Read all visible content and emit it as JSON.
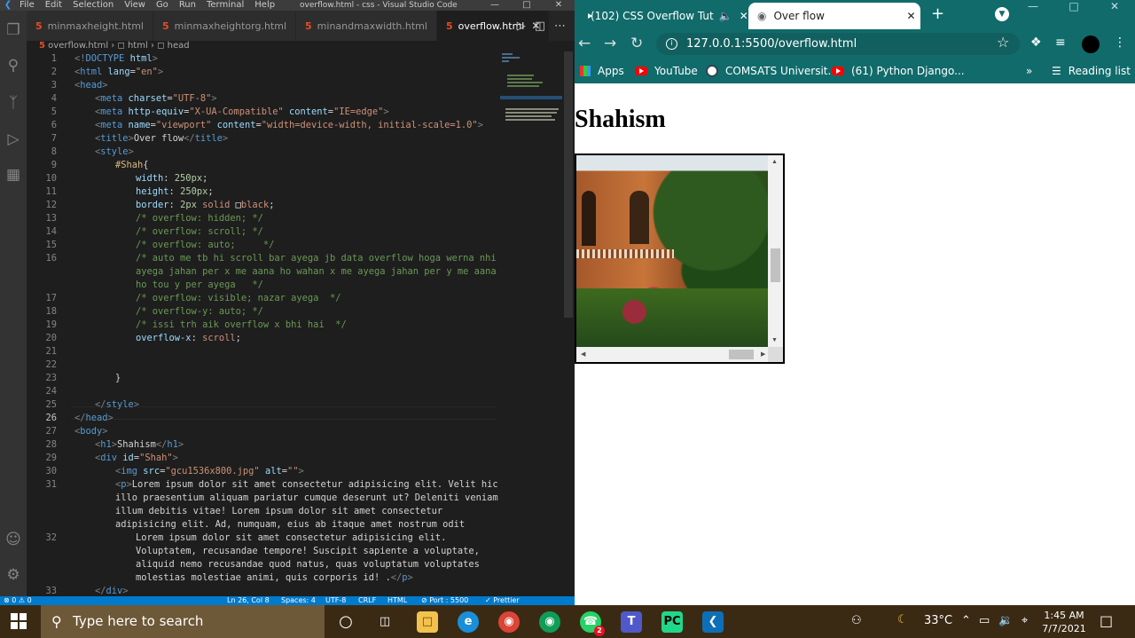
{
  "vscode": {
    "menu": [
      "File",
      "Edit",
      "Selection",
      "View",
      "Go",
      "Run",
      "Terminal",
      "Help"
    ],
    "title": "overflow.html - css - Visual Studio Code",
    "tabs": [
      {
        "label": "minmaxheight.html"
      },
      {
        "label": "minmaxheightorg.html"
      },
      {
        "label": "minandmaxwidth.html"
      },
      {
        "label": "overflow.html",
        "active": true
      }
    ],
    "breadcrumb": [
      "overflow.html",
      "html",
      "head"
    ],
    "line_numbers": [
      "1",
      "2",
      "3",
      "4",
      "5",
      "6",
      "7",
      "8",
      "9",
      "10",
      "11",
      "12",
      "13",
      "14",
      "15",
      "16",
      "",
      "",
      "17",
      "18",
      "19",
      "20",
      "21",
      "22",
      "23",
      "24",
      "25",
      "26",
      "27",
      "28",
      "29",
      "30",
      "31",
      "",
      "",
      "",
      "32",
      "",
      "",
      "",
      "33"
    ],
    "code": [
      {
        "ind": 0,
        "parts": [
          [
            "t",
            "<!"
          ],
          [
            "n",
            "DOCTYPE"
          ],
          [
            "a",
            " html"
          ],
          [
            "t",
            ">"
          ]
        ]
      },
      {
        "ind": 0,
        "parts": [
          [
            "t",
            "<"
          ],
          [
            "n",
            "html"
          ],
          [
            "a",
            " lang"
          ],
          [
            "d",
            "="
          ],
          [
            "s",
            "\"en\""
          ],
          [
            "t",
            ">"
          ]
        ]
      },
      {
        "ind": 0,
        "parts": [
          [
            "t",
            "<"
          ],
          [
            "n",
            "head"
          ],
          [
            "t",
            ">"
          ]
        ]
      },
      {
        "ind": 1,
        "parts": [
          [
            "t",
            "<"
          ],
          [
            "n",
            "meta"
          ],
          [
            "a",
            " charset"
          ],
          [
            "d",
            "="
          ],
          [
            "s",
            "\"UTF-8\""
          ],
          [
            "t",
            ">"
          ]
        ]
      },
      {
        "ind": 1,
        "parts": [
          [
            "t",
            "<"
          ],
          [
            "n",
            "meta"
          ],
          [
            "a",
            " http-equiv"
          ],
          [
            "d",
            "="
          ],
          [
            "s",
            "\"X-UA-Compatible\""
          ],
          [
            "a",
            " content"
          ],
          [
            "d",
            "="
          ],
          [
            "s",
            "\"IE=edge\""
          ],
          [
            "t",
            ">"
          ]
        ]
      },
      {
        "ind": 1,
        "parts": [
          [
            "t",
            "<"
          ],
          [
            "n",
            "meta"
          ],
          [
            "a",
            " name"
          ],
          [
            "d",
            "="
          ],
          [
            "s",
            "\"viewport\""
          ],
          [
            "a",
            " content"
          ],
          [
            "d",
            "="
          ],
          [
            "s",
            "\"width=device-width, initial-scale=1.0\""
          ],
          [
            "t",
            ">"
          ]
        ]
      },
      {
        "ind": 1,
        "parts": [
          [
            "t",
            "<"
          ],
          [
            "n",
            "title"
          ],
          [
            "t",
            ">"
          ],
          [
            "d",
            "Over flow"
          ],
          [
            "t",
            "</"
          ],
          [
            "n",
            "title"
          ],
          [
            "t",
            ">"
          ]
        ]
      },
      {
        "ind": 1,
        "parts": [
          [
            "t",
            "<"
          ],
          [
            "n",
            "style"
          ],
          [
            "t",
            ">"
          ]
        ]
      },
      {
        "ind": 2,
        "parts": [
          [
            "sel",
            "#Shah"
          ],
          [
            "d",
            "{"
          ]
        ]
      },
      {
        "ind": 3,
        "parts": [
          [
            "p",
            "width"
          ],
          [
            "d",
            ": "
          ],
          [
            "v",
            "250px"
          ],
          [
            "d",
            ";"
          ]
        ]
      },
      {
        "ind": 3,
        "parts": [
          [
            "p",
            "height"
          ],
          [
            "d",
            ": "
          ],
          [
            "v",
            "250px"
          ],
          [
            "d",
            ";"
          ]
        ]
      },
      {
        "ind": 3,
        "parts": [
          [
            "p",
            "border"
          ],
          [
            "d",
            ": "
          ],
          [
            "v",
            "2px"
          ],
          [
            "d",
            " "
          ],
          [
            "s",
            "solid"
          ],
          [
            "d",
            " "
          ],
          [
            "sw",
            "□"
          ],
          [
            "s",
            "black"
          ],
          [
            "d",
            ";"
          ]
        ]
      },
      {
        "ind": 3,
        "parts": [
          [
            "c",
            "/* overflow: hidden; */"
          ]
        ]
      },
      {
        "ind": 3,
        "parts": [
          [
            "c",
            "/* overflow: scroll; */"
          ]
        ]
      },
      {
        "ind": 3,
        "parts": [
          [
            "c",
            "/* overflow: auto;     */"
          ]
        ]
      },
      {
        "ind": 3,
        "parts": [
          [
            "c",
            "/* auto me tb hi scroll bar ayega jb data overflow hoga werna nhi"
          ]
        ]
      },
      {
        "ind": 3,
        "parts": [
          [
            "c",
            "ayega jahan per x me aana ho wahan x me ayega jahan per y me aana"
          ]
        ]
      },
      {
        "ind": 3,
        "parts": [
          [
            "c",
            "ho tou y per ayega   */"
          ]
        ]
      },
      {
        "ind": 3,
        "parts": [
          [
            "c",
            "/* overflow: visible; nazar ayega  */"
          ]
        ]
      },
      {
        "ind": 3,
        "parts": [
          [
            "c",
            "/* overflow-y: auto; */"
          ]
        ]
      },
      {
        "ind": 3,
        "parts": [
          [
            "c",
            "/* issi trh aik overflow x bhi hai  */"
          ]
        ]
      },
      {
        "ind": 3,
        "parts": [
          [
            "p",
            "overflow-x"
          ],
          [
            "d",
            ": "
          ],
          [
            "s",
            "scroll"
          ],
          [
            "d",
            ";"
          ]
        ]
      },
      {
        "ind": 0,
        "parts": []
      },
      {
        "ind": 0,
        "parts": []
      },
      {
        "ind": 2,
        "parts": [
          [
            "d",
            "}"
          ]
        ]
      },
      {
        "ind": 0,
        "parts": []
      },
      {
        "ind": 1,
        "parts": [
          [
            "t",
            "</"
          ],
          [
            "n",
            "style"
          ],
          [
            "t",
            ">"
          ]
        ]
      },
      {
        "ind": 0,
        "parts": [
          [
            "t",
            "</"
          ],
          [
            "n",
            "head"
          ],
          [
            "t",
            ">"
          ]
        ]
      },
      {
        "ind": 0,
        "parts": [
          [
            "t",
            "<"
          ],
          [
            "n",
            "body"
          ],
          [
            "t",
            ">"
          ]
        ]
      },
      {
        "ind": 1,
        "parts": [
          [
            "t",
            "<"
          ],
          [
            "n",
            "h1"
          ],
          [
            "t",
            ">"
          ],
          [
            "d",
            "Shahism"
          ],
          [
            "t",
            "</"
          ],
          [
            "n",
            "h1"
          ],
          [
            "t",
            ">"
          ]
        ]
      },
      {
        "ind": 1,
        "parts": [
          [
            "t",
            "<"
          ],
          [
            "n",
            "div"
          ],
          [
            "a",
            " id"
          ],
          [
            "d",
            "="
          ],
          [
            "s",
            "\"Shah\""
          ],
          [
            "t",
            ">"
          ]
        ]
      },
      {
        "ind": 2,
        "parts": [
          [
            "t",
            "<"
          ],
          [
            "n",
            "img"
          ],
          [
            "a",
            " src"
          ],
          [
            "d",
            "="
          ],
          [
            "s",
            "\"gcu1536x800.jpg\""
          ],
          [
            "a",
            " alt"
          ],
          [
            "d",
            "="
          ],
          [
            "s",
            "\"\""
          ],
          [
            "t",
            ">"
          ]
        ]
      },
      {
        "ind": 2,
        "parts": [
          [
            "t",
            "<"
          ],
          [
            "n",
            "p"
          ],
          [
            "t",
            ">"
          ],
          [
            "d",
            "Lorem ipsum dolor sit amet consectetur adipisicing elit. Velit hic"
          ]
        ]
      },
      {
        "ind": 2,
        "parts": [
          [
            "d",
            "illo praesentium aliquam pariatur cumque deserunt ut? Deleniti veniam"
          ]
        ]
      },
      {
        "ind": 2,
        "parts": [
          [
            "d",
            "illum debitis vitae! Lorem ipsum dolor sit amet consectetur"
          ]
        ]
      },
      {
        "ind": 2,
        "parts": [
          [
            "d",
            "adipisicing elit. Ad, numquam, eius ab itaque amet nostrum odit"
          ]
        ]
      },
      {
        "ind": 3,
        "parts": [
          [
            "d",
            "Lorem ipsum dolor sit amet consectetur adipisicing elit."
          ]
        ]
      },
      {
        "ind": 3,
        "parts": [
          [
            "d",
            "Voluptatem, recusandae tempore! Suscipit sapiente a voluptate,"
          ]
        ]
      },
      {
        "ind": 3,
        "parts": [
          [
            "d",
            "aliquid nemo recusandae quod natus, quas voluptatum voluptates"
          ]
        ]
      },
      {
        "ind": 3,
        "parts": [
          [
            "d",
            "molestias molestiae animi, quis corporis id! ."
          ],
          [
            "t",
            "</"
          ],
          [
            "n",
            "p"
          ],
          [
            "t",
            ">"
          ]
        ]
      },
      {
        "ind": 1,
        "parts": [
          [
            "t",
            "</"
          ],
          [
            "n",
            "div"
          ],
          [
            "t",
            ">"
          ]
        ]
      }
    ],
    "status": {
      "left": "⊗ 0 ⚠ 0",
      "position": "Ln 26, Col 8",
      "spaces": "Spaces: 4",
      "encoding": "UTF-8",
      "eol": "CRLF",
      "language": "HTML",
      "port": "⊘ Port : 5500",
      "prettier": "✓ Prettier"
    }
  },
  "chrome": {
    "tabs": [
      {
        "title": "(102) CSS Overflow Tut",
        "favicon": "youtube-icon"
      },
      {
        "title": "Over flow",
        "favicon": "globe-icon",
        "active": true
      }
    ],
    "url": "127.0.0.1:5500/overflow.html",
    "bookmarks": [
      {
        "label": "Apps",
        "icon": "apps-grid-icon"
      },
      {
        "label": "YouTube",
        "icon": "youtube-icon"
      },
      {
        "label": "COMSATS Universit...",
        "icon": "university-icon"
      },
      {
        "label": "(61) Python Django...",
        "icon": "youtube-icon"
      }
    ],
    "reading_list": "Reading list",
    "page": {
      "heading": "Shahism"
    }
  },
  "taskbar": {
    "search_placeholder": "Type here to search",
    "temperature": "33°C",
    "time": "1:45 AM",
    "date": "7/7/2021",
    "whatsapp_badge": "2"
  },
  "colors": {
    "vscode_bg": "#1e1e1e",
    "statusbar": "#007acc",
    "chrome_frame": "#116b6b",
    "taskbar": "#3a2a14"
  }
}
